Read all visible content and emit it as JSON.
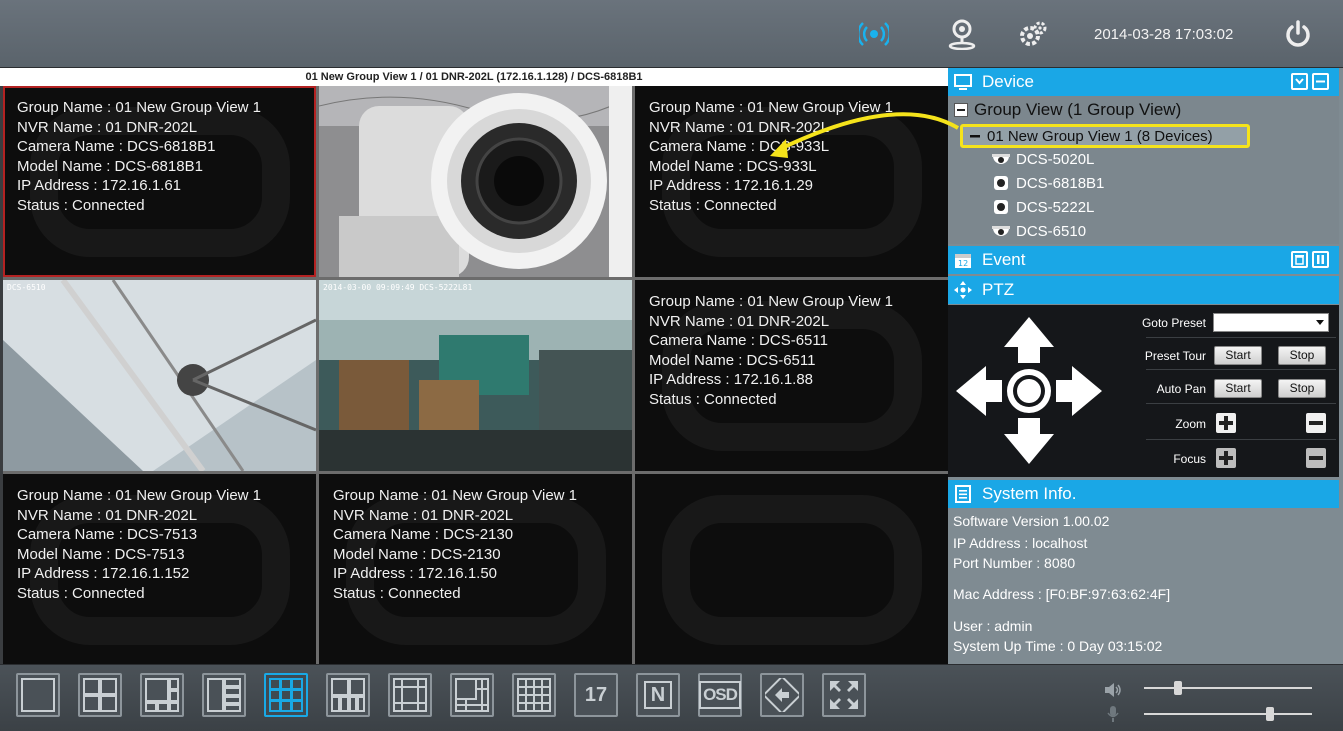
{
  "topbar": {
    "datetime": "2014-03-28 17:03:02",
    "icons": [
      "live-view-icon",
      "map-location-icon",
      "settings-icon",
      "power-icon"
    ]
  },
  "video": {
    "title": "01 New Group View 1 / 01 DNR-202L (172.16.1.128) / DCS-6818B1",
    "cells": [
      {
        "lines": [
          "Group Name : 01 New Group View 1",
          "NVR Name : 01 DNR-202L",
          "Camera Name : DCS-6818B1",
          "Model Name : DCS-6818B1",
          "IP Address : 172.16.1.61",
          "Status : Connected"
        ]
      },
      {
        "overlay": ""
      },
      {
        "lines": [
          "Group Name : 01 New Group View 1",
          "NVR Name : 01 DNR-202L",
          "Camera Name : DCS-933L",
          "Model Name : DCS-933L",
          "IP Address : 172.16.1.29",
          "Status : Connected"
        ]
      },
      {
        "overlay": "DCS-6510"
      },
      {
        "overlay": "2014-03-00 09:09:49 DCS-5222L81"
      },
      {
        "lines": [
          "Group Name : 01 New Group View 1",
          "NVR Name : 01 DNR-202L",
          "Camera Name : DCS-6511",
          "Model Name : DCS-6511",
          "IP Address : 172.16.1.88",
          "Status : Connected"
        ]
      },
      {
        "lines": [
          "Group Name : 01 New Group View 1",
          "NVR Name : 01 DNR-202L",
          "Camera Name : DCS-7513",
          "Model Name : DCS-7513",
          "IP Address : 172.16.1.152",
          "Status : Connected"
        ]
      },
      {
        "lines": [
          "Group Name : 01 New Group View 1",
          "NVR Name : 01 DNR-202L",
          "Camera Name : DCS-2130",
          "Model Name : DCS-2130",
          "IP Address : 172.16.1.50",
          "Status : Connected"
        ]
      },
      {
        "lines": []
      }
    ]
  },
  "device": {
    "header": "Device",
    "group_view": "Group View   (1 Group View)",
    "group_item": "01 New Group View 1   (8 Devices)",
    "devices": [
      "DCS-5020L",
      "DCS-6818B1",
      "DCS-5222L",
      "DCS-6510"
    ]
  },
  "event": {
    "header": "Event"
  },
  "ptz": {
    "header": "PTZ",
    "goto_preset": "Goto Preset",
    "preset_tour": "Preset Tour",
    "auto_pan": "Auto Pan",
    "zoom": "Zoom",
    "focus": "Focus",
    "start": "Start",
    "stop": "Stop",
    "preset_value": ""
  },
  "sysinfo": {
    "header": "System Info.",
    "software": "Software Version 1.00.02",
    "ip": "IP Address : localhost",
    "port": "Port Number : 8080",
    "mac": "Mac Address : [F0:BF:97:63:62:4F]",
    "user": "User : admin",
    "uptime": "System Up Time : 0 Day 03:15:02"
  },
  "bottombar": {
    "layout_labels": {
      "seventeen": "17",
      "n": "N",
      "osd": "OSD"
    },
    "volume_level": 0.2,
    "mic_level": 0.75
  },
  "colors": {
    "accent": "#1aa7e6",
    "highlight": "#f5e31b",
    "selected": "#b32222"
  }
}
